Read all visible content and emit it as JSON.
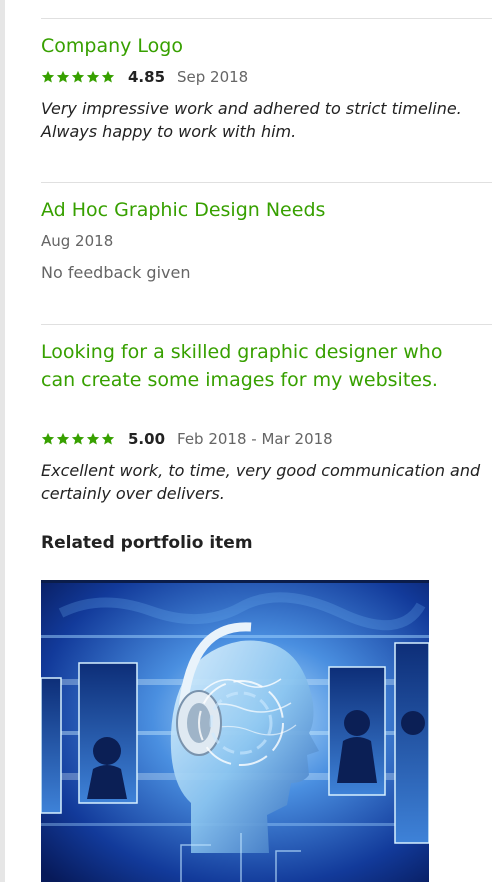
{
  "jobs": [
    {
      "title": "Company Logo",
      "rating_stars": 5,
      "score": "4.85",
      "date": "Sep 2018",
      "feedback": "Very impressive work and adhered to strict timeline. Always happy to work with him."
    },
    {
      "title": "Ad Hoc Graphic Design Needs",
      "date": "Aug 2018",
      "feedback": "No feedback given"
    },
    {
      "title": "Looking for a skilled graphic designer who can create some images for my websites.",
      "rating_stars": 5,
      "score": "5.00",
      "date": "Feb 2018 - Mar 2018",
      "feedback": "Excellent work, to time, very good communication and certainly over delivers."
    }
  ],
  "related_portfolio": {
    "heading": "Related portfolio item",
    "image_icon": "portfolio-image-headphones-brain"
  },
  "colors": {
    "accent_green": "#37a000",
    "star_green": "#37a000",
    "text_dark": "#222222",
    "text_muted": "#656565",
    "divider": "#e0e0e0"
  }
}
